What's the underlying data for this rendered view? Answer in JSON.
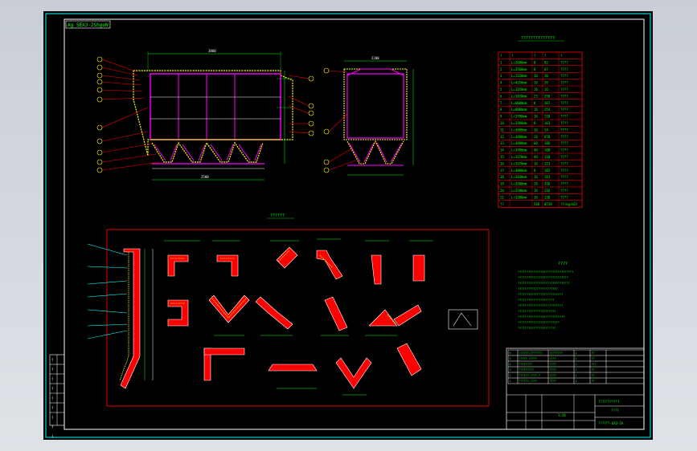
{
  "title_tag": "Ag SEX3-2ShgoN",
  "table": {
    "title": "??????????????",
    "headers": [
      "?",
      "?",
      "?",
      "?",
      "?"
    ],
    "rows": [
      [
        "1",
        "L=2680mm",
        "8",
        "82",
        "????"
      ],
      [
        "2",
        "L=2560mm",
        "8",
        "67",
        "????"
      ],
      [
        "3",
        "L=1120mm",
        "16",
        "20",
        "????"
      ],
      [
        "4",
        "L=4250mm",
        "16",
        "39",
        "????"
      ],
      [
        "5",
        "L=1250mm",
        "16",
        "16",
        "????"
      ],
      [
        "6",
        "L=1420mm",
        "23",
        "256",
        "????"
      ],
      [
        "7",
        "L=6000mm",
        "8",
        "107",
        "????"
      ],
      [
        "8",
        "L=6000mm",
        "16",
        "254",
        "????"
      ],
      [
        "9",
        "L=2790mm",
        "16",
        "110",
        "????"
      ],
      [
        "10",
        "L=3390mm",
        "8",
        "103",
        "????"
      ],
      [
        "11",
        "L=3400mm",
        "16",
        "54",
        "????"
      ],
      [
        "12",
        "L=3400mm",
        "20",
        "670",
        "????"
      ],
      [
        "13",
        "L=3400mm",
        "60",
        "186",
        "????"
      ],
      [
        "14",
        "L=3780mm",
        "40",
        "100",
        "????"
      ],
      [
        "15",
        "L=3370mm",
        "40",
        "110",
        "????"
      ],
      [
        "16",
        "L=3370mm",
        "16",
        "131",
        "????"
      ],
      [
        "17",
        "L=3800mm",
        "8",
        "182",
        "????"
      ],
      [
        "18",
        "L=3330mm",
        "16",
        "181",
        "????"
      ],
      [
        "19",
        "L=3300mm",
        "20",
        "316",
        "????"
      ],
      [
        "20",
        "L=2200mm",
        "16",
        "316",
        "????"
      ],
      [
        "21",
        "L=2280mm",
        "16",
        "136",
        "????"
      ]
    ],
    "total": [
      "??",
      "",
      "546",
      "8739",
      "??(kg/m2)"
    ]
  },
  "section_label": "??????",
  "notes_label": "????",
  "notes": [
    "????????????????????????????????",
    "?????????????????????????????",
    "??????????????????????????????",
    "???????????????????????",
    "??????????????????????????",
    "?????????????????????",
    "??????????????????????????",
    "??????????????????????",
    "???????????????????????????",
    "????????????????????????",
    "??????????????????????"
  ],
  "title_block": {
    "rows": [
      [
        "6",
        "??????-???????",
        "????????",
        "1",
        "??"
      ],
      [
        "5",
        "?????-?????",
        "????",
        "1",
        "??"
      ],
      [
        "4",
        "????????",
        "????",
        "1",
        "???"
      ],
      [
        "3",
        "?????????",
        "????",
        "1",
        "??"
      ],
      [
        "2",
        "??????-????-?",
        "????",
        "1",
        "??"
      ],
      [
        "1",
        "??????-????",
        "????",
        "1",
        "??"
      ]
    ],
    "drawing_name": "???????????",
    "part_name": "????",
    "drawing_no": "??????-6X3-1A",
    "sheet": "1:20"
  },
  "side_labels": [
    "?",
    "?",
    "?",
    "?",
    "?",
    "?",
    "?",
    "?",
    "?"
  ],
  "colors": {
    "frame": "#ffffff",
    "structure": "#ffff00",
    "hopper": "#ff00ff",
    "dimension": "#00ff00",
    "leader": "#ff0000",
    "table_grid": "#ff0000",
    "text": "#00ff00",
    "border_cyan": "#00ffff"
  }
}
